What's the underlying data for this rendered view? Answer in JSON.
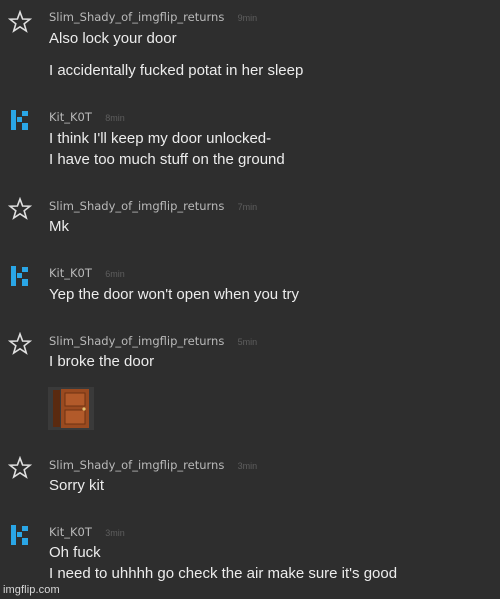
{
  "messages": [
    {
      "author": "Slim_Shady_of_imgflip_returns",
      "time": "9min",
      "lines": [
        "Also lock your door",
        "I accidentally fucked potat in her sleep"
      ]
    },
    {
      "author": "Kit_K0T",
      "time": "8min",
      "lines": [
        "I think I'll keep my door unlocked-",
        "I have too much stuff on the ground"
      ]
    },
    {
      "author": "Slim_Shady_of_imgflip_returns",
      "time": "7min",
      "lines": [
        "Mk"
      ]
    },
    {
      "author": "Kit_K0T",
      "time": "6min",
      "lines": [
        "Yep the door won't open when you try"
      ]
    },
    {
      "author": "Slim_Shady_of_imgflip_returns",
      "time": "5min",
      "lines": [
        "I broke the door"
      ]
    },
    {
      "author": "Slim_Shady_of_imgflip_returns",
      "time": "3min",
      "lines": [
        "Sorry kit"
      ]
    },
    {
      "author": "Kit_K0T",
      "time": "3min",
      "lines": [
        "Oh fuck",
        "I need to uhhhh go check the air make sure it's good"
      ]
    }
  ],
  "watermark": "imgflip.com",
  "colors": {
    "background": "#2e2e2e",
    "kit_avatar": "#2aa6e6",
    "door": "#9a4a20"
  }
}
